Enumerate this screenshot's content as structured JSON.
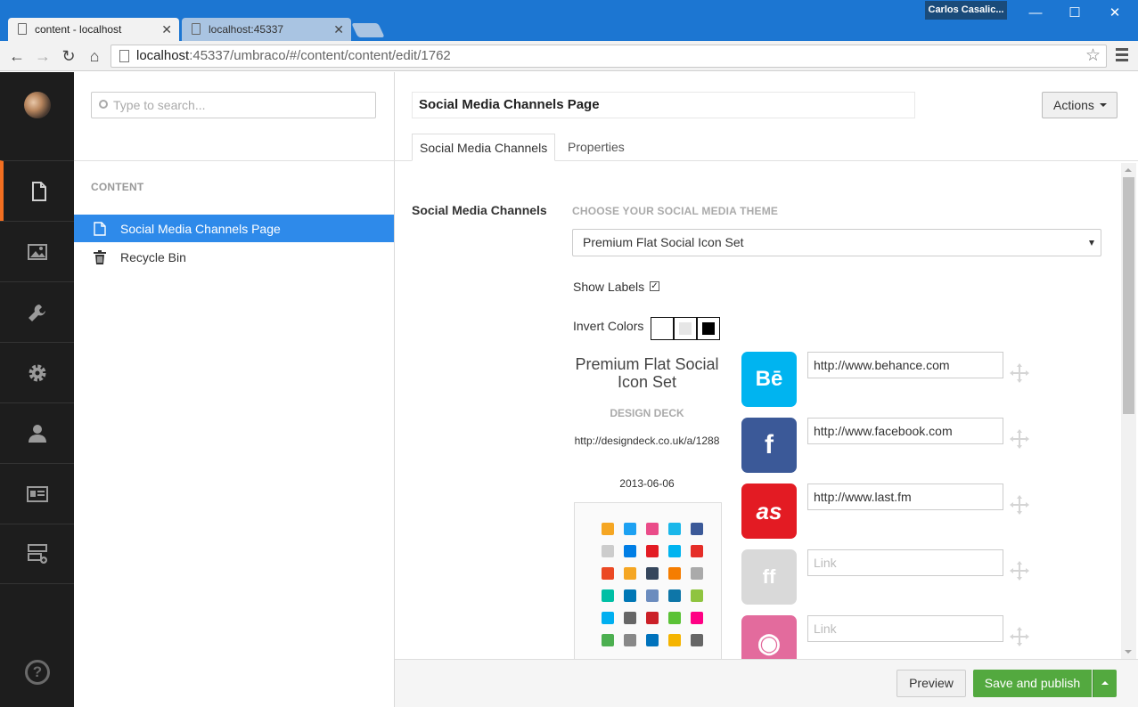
{
  "browser": {
    "user_name": "Carlos Casalic...",
    "tabs": [
      {
        "title": "content - localhost",
        "active": true
      },
      {
        "title": "localhost:45337",
        "active": false
      }
    ],
    "url_host": "localhost",
    "url_rest": ":45337/umbraco/#/content/content/edit/1762",
    "window_controls": {
      "minimize": "—",
      "maximize": "☐",
      "close": "✕"
    }
  },
  "sidebar": {
    "items": [
      {
        "icon": "document-icon",
        "active": true
      },
      {
        "icon": "image-icon",
        "active": false
      },
      {
        "icon": "wrench-icon",
        "active": false
      },
      {
        "icon": "gear-icon",
        "active": false
      },
      {
        "icon": "user-icon",
        "active": false
      },
      {
        "icon": "id-card-icon",
        "active": false
      },
      {
        "icon": "form-add-icon",
        "active": false
      }
    ],
    "help": "?"
  },
  "tree": {
    "search_placeholder": "Type to search...",
    "heading": "CONTENT",
    "items": [
      {
        "label": "Social Media Channels Page",
        "icon": "document-icon",
        "selected": true
      },
      {
        "label": "Recycle Bin",
        "icon": "trash-icon",
        "selected": false
      }
    ]
  },
  "editor": {
    "node_name": "Social Media Channels Page",
    "actions_label": "Actions",
    "tabs": [
      "Social Media Channels",
      "Properties"
    ],
    "property_label": "Social Media Channels",
    "theme_section_label": "CHOOSE YOUR SOCIAL MEDIA THEME",
    "theme_selected": "Premium Flat Social Icon Set",
    "show_labels_label": "Show Labels",
    "show_labels_checked": true,
    "invert_colors_label": "Invert Colors",
    "theme_info": {
      "title": "Premium Flat Social Icon Set",
      "author": "DESIGN DECK",
      "url": "http://designdeck.co.uk/a/1288",
      "date": "2013-06-06"
    },
    "channels": [
      {
        "name": "behance",
        "glyph": "Bē",
        "color": "#00b4f0",
        "value": "http://www.behance.com",
        "placeholder": "Link"
      },
      {
        "name": "facebook",
        "glyph": "f",
        "color": "#3b5998",
        "value": "http://www.facebook.com",
        "placeholder": "Link"
      },
      {
        "name": "lastfm",
        "glyph": "as",
        "color": "#e31b23",
        "value": "http://www.last.fm",
        "placeholder": "Link"
      },
      {
        "name": "friendfeed",
        "glyph": "ff",
        "color": "#d9d9d9",
        "value": "",
        "placeholder": "Link"
      },
      {
        "name": "dribbble",
        "glyph": "◉",
        "color": "#e36b9d",
        "value": "",
        "placeholder": "Link"
      }
    ],
    "preview_button": "Preview",
    "save_publish_button": "Save and publish"
  },
  "colors": {
    "accent_blue": "#2e8aea",
    "sidebar_bg": "#1d1d1d",
    "active_marker": "#f36f21",
    "save_green": "#53a93f",
    "chrome_title": "#1c76d2"
  }
}
